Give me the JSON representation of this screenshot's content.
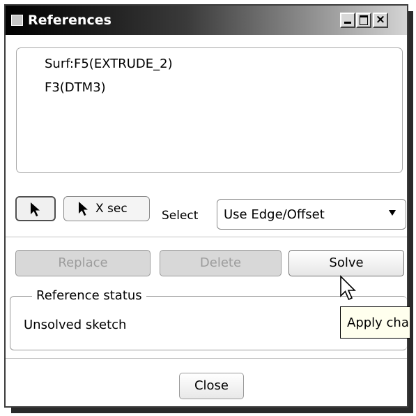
{
  "window": {
    "title": "References",
    "controls": {
      "minimize": "_",
      "maximize": "□",
      "close": "×"
    }
  },
  "references": {
    "items": [
      "Surf:F5(EXTRUDE_2)",
      "F3(DTM3)"
    ]
  },
  "toolbar": {
    "select_tool_icon": "arrow-cursor-icon",
    "xsec_label": "X sec",
    "select_label": "Select",
    "select_dropdown_value": "Use Edge/Offset"
  },
  "actions": {
    "replace_label": "Replace",
    "delete_label": "Delete",
    "solve_label": "Solve",
    "replace_enabled": false,
    "delete_enabled": false
  },
  "status": {
    "legend": "Reference status",
    "text": "Unsolved sketch",
    "tooltip": "Apply cha"
  },
  "footer": {
    "close_label": "Close"
  },
  "colors": {
    "titlebar_start": "#000000",
    "titlebar_end": "#d4d4d4",
    "disabled_text": "#9c9c9c",
    "tooltip_bg": "#ffffee"
  }
}
